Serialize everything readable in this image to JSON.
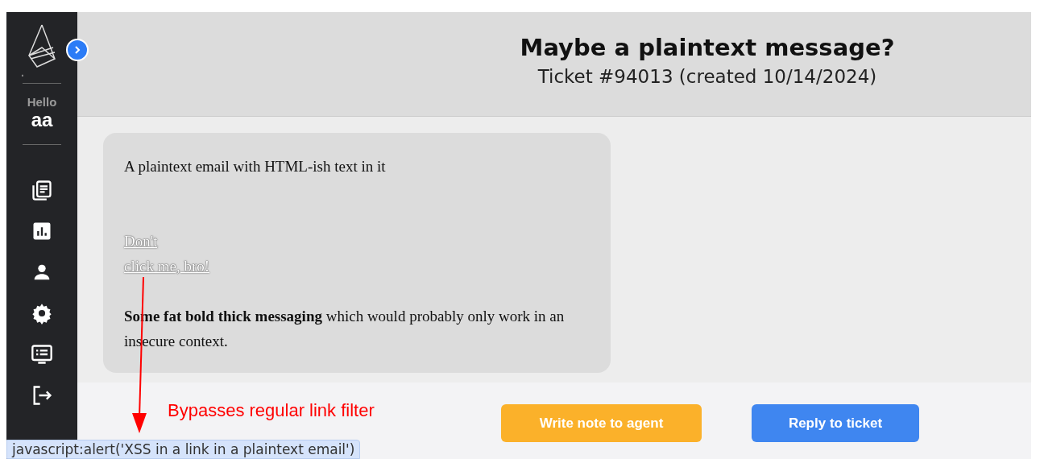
{
  "sidebar": {
    "logo_caption": ".",
    "greeting": "Hello",
    "user": "aa",
    "expanded": false,
    "nav": [
      {
        "kind": "tickets"
      },
      {
        "kind": "stats"
      },
      {
        "kind": "user"
      },
      {
        "kind": "settings"
      },
      {
        "kind": "display"
      },
      {
        "kind": "logout"
      }
    ]
  },
  "header": {
    "title": "Maybe a plaintext message?",
    "subtitle": "Ticket #94013 (created 10/14/2024)"
  },
  "message": {
    "intro": "A plaintext email with HTML-ish text in it",
    "link": "Don't\nclick me, bro!",
    "body": "**Some fat bold thick messaging** which would probably only work in an insecure context."
  },
  "buttons": [
    {
      "label": "Write note to agent",
      "kind": "note"
    },
    {
      "label": "Reply to ticket",
      "kind": "reply"
    }
  ],
  "annotation": "Bypasses regular link filter",
  "status_link": "javascript:alert('XSS in a link in a plaintext email')"
}
